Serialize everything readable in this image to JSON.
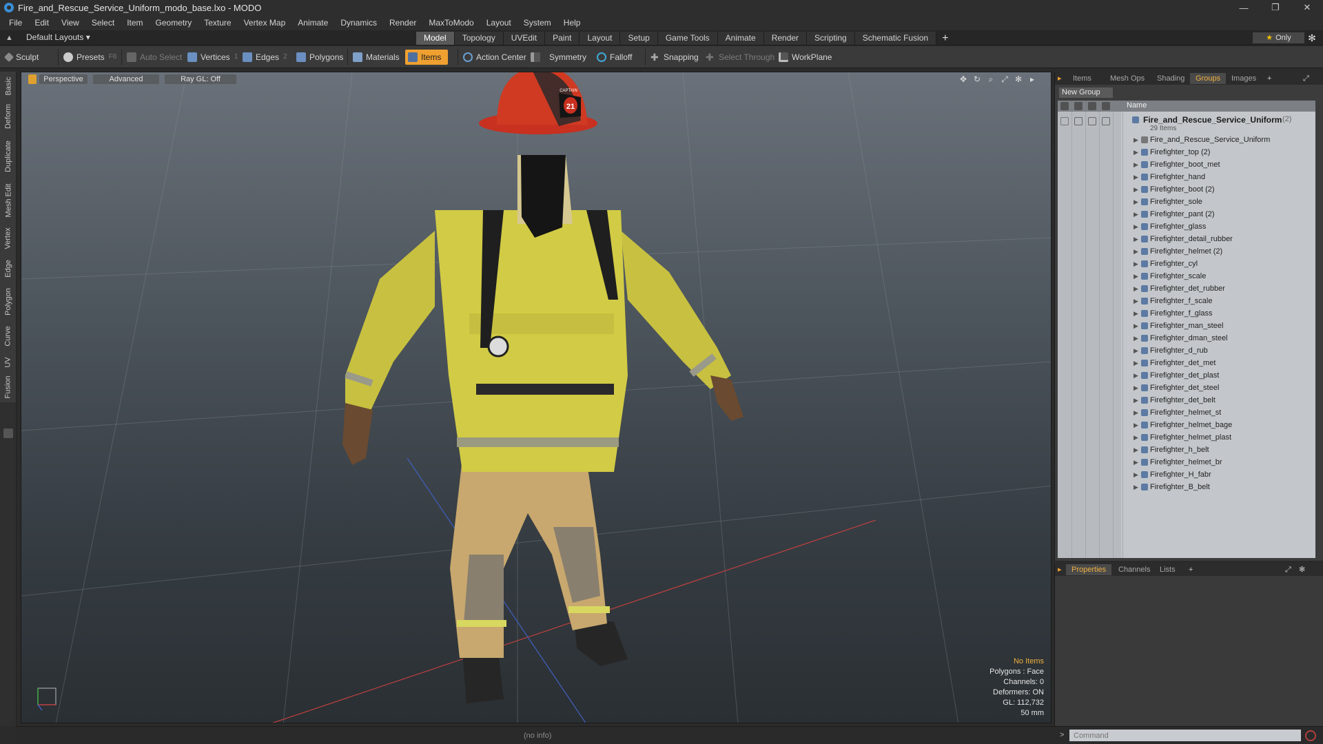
{
  "window": {
    "title": "Fire_and_Rescue_Service_Uniform_modo_base.lxo - MODO",
    "controls": [
      "—",
      "❐",
      "✕"
    ]
  },
  "menu": [
    "File",
    "Edit",
    "View",
    "Select",
    "Item",
    "Geometry",
    "Texture",
    "Vertex Map",
    "Animate",
    "Dynamics",
    "Render",
    "MaxToModo",
    "Layout",
    "System",
    "Help"
  ],
  "layoutbar": {
    "layout_selector": "Default Layouts ▾",
    "tabs": [
      "Model",
      "Topology",
      "UVEdit",
      "Paint",
      "Layout",
      "Setup",
      "Game Tools",
      "Animate",
      "Render",
      "Scripting",
      "Schematic Fusion"
    ],
    "active_tab": "Model",
    "only_star": "★",
    "only_label": "Only"
  },
  "toolbar": {
    "sculpt": "Sculpt",
    "presets": "Presets",
    "presets_key": "F6",
    "auto_select": "Auto Select",
    "vertices": "Vertices",
    "vertices_key": "1",
    "edges": "Edges",
    "edges_key": "2",
    "polygons": "Polygons",
    "materials": "Materials",
    "items": "Items",
    "action_center": "Action Center",
    "symmetry": "Symmetry",
    "falloff": "Falloff",
    "snapping": "Snapping",
    "select_through": "Select Through",
    "workplane": "WorkPlane"
  },
  "left_tabs": [
    "Basic",
    "Deform",
    "Duplicate",
    "Mesh Edit",
    "Vertex",
    "Edge",
    "Polygon",
    "Curve",
    "UV",
    "Fusion"
  ],
  "viewport": {
    "view_mode": "Perspective",
    "shading": "Advanced",
    "raygl": "Ray GL: Off",
    "helmet_number": "21",
    "helmet_text": "CAPTAIN",
    "hud": {
      "selection": "No Items",
      "polygons": "Polygons : Face",
      "channels": "Channels: 0",
      "deformers": "Deformers: ON",
      "gl": "GL: 112,732",
      "focal": "50 mm"
    }
  },
  "right_panel": {
    "tabs": [
      "Items",
      "Mesh Ops",
      "Shading",
      "Groups",
      "Images"
    ],
    "active_tab": "Groups",
    "new_group": "New Group",
    "column_name": "Name",
    "root": {
      "name": "Fire_and_Rescue_Service_Uniform",
      "count": "(2)",
      "sub": "29 Items"
    },
    "items": [
      "Fire_and_Rescue_Service_Uniform",
      "Firefighter_top (2)",
      "Firefighter_boot_met",
      "Firefighter_hand",
      "Firefighter_boot (2)",
      "Firefighter_sole",
      "Firefighter_pant (2)",
      "Firefighter_glass",
      "Firefighter_detail_rubber",
      "Firefighter_helmet (2)",
      "Firefighter_cyl",
      "Firefighter_scale",
      "Firefighter_det_rubber",
      "Firefighter_f_scale",
      "Firefighter_f_glass",
      "Firefighter_man_steel",
      "Firefighter_dman_steel",
      "Firefighter_d_rub",
      "Firefighter_det_met",
      "Firefighter_det_plast",
      "Firefighter_det_steel",
      "Firefighter_det_belt",
      "Firefighter_helmet_st",
      "Firefighter_helmet_bage",
      "Firefighter_helmet_plast",
      "Firefighter_h_belt",
      "Firefighter_helmet_br",
      "Firefighter_H_fabr",
      "Firefighter_B_belt"
    ]
  },
  "properties_panel": {
    "tabs": [
      "Properties",
      "Channels",
      "Lists"
    ],
    "active_tab": "Properties"
  },
  "status": {
    "info": "(no info)",
    "command_placeholder": "Command",
    "prompt": ">"
  },
  "colors": {
    "accent": "#f0a030",
    "active_tab_text": "#f0b040",
    "viewport_top": "#6a717a",
    "viewport_bottom": "#2a2f33"
  }
}
